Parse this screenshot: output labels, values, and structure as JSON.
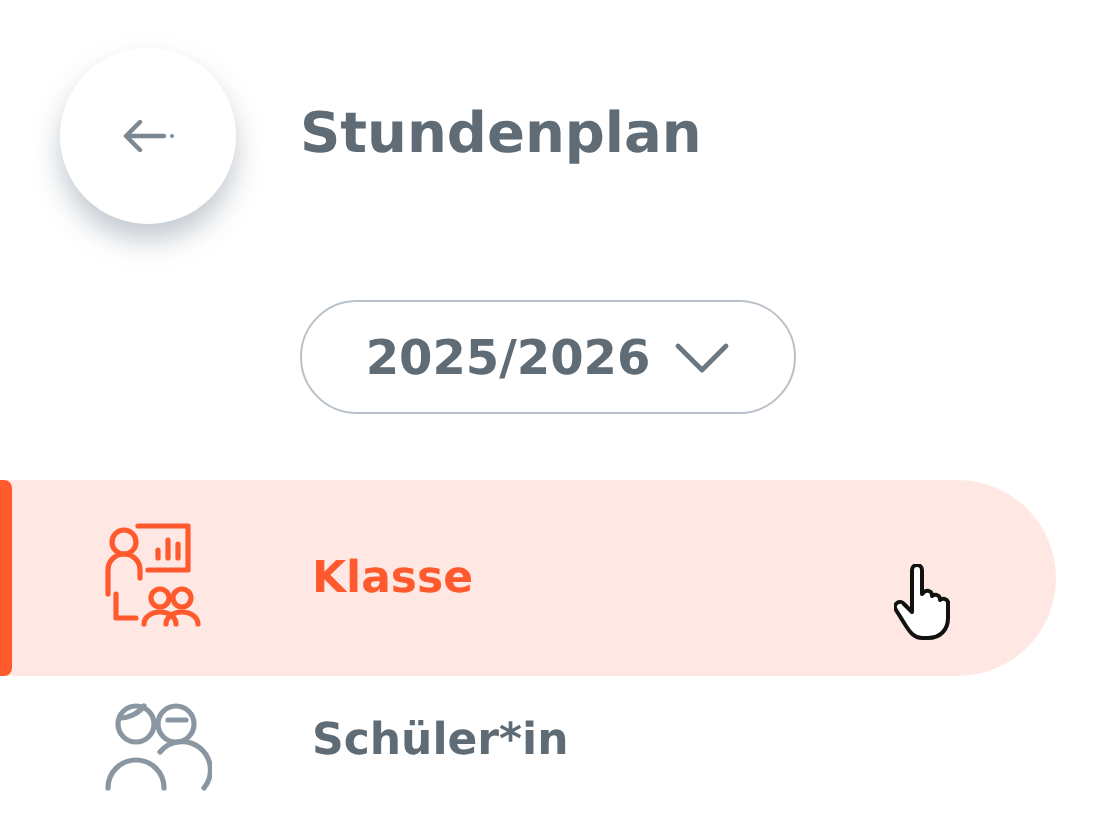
{
  "header": {
    "title": "Stundenplan"
  },
  "year_select": {
    "value": "2025/2026"
  },
  "nav_items": [
    {
      "label": "Klasse",
      "kind": "class",
      "selected": true
    },
    {
      "label": "Schüler*in",
      "kind": "students",
      "selected": false
    }
  ]
}
